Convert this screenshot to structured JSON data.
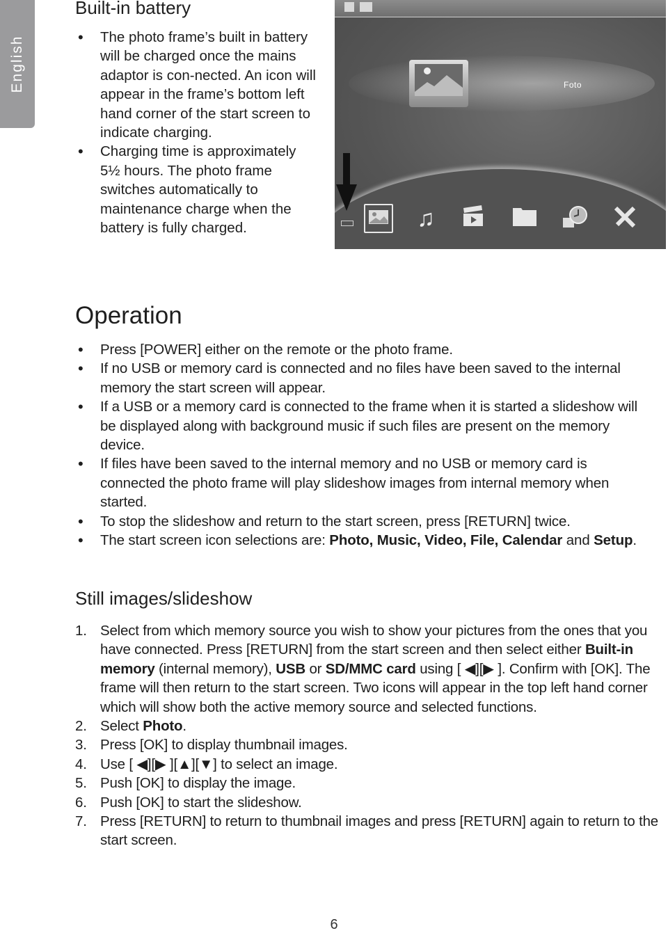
{
  "side_tab": {
    "label": "English"
  },
  "battery_section": {
    "heading": "Built-in battery",
    "bullets": [
      "The photo frame’s built in battery will be charged once the mains adaptor is con-nected. An icon will appear in the frame’s bottom left hand corner of the start screen to indicate charging.",
      "Charging time is approximately 5½ hours. The photo frame switches automatically to maintenance charge when the battery is fully charged."
    ]
  },
  "screen_image": {
    "selected_label": "Foto",
    "menu_icons": [
      "photo-icon",
      "music-icon",
      "video-icon",
      "file-icon",
      "calendar-icon",
      "setup-icon"
    ],
    "indicator": "battery-charging-icon",
    "pointer": "down-arrow-icon"
  },
  "operation_section": {
    "heading": "Operation",
    "bullets": [
      {
        "text": "Press [POWER] either on the remote or the photo frame."
      },
      {
        "text": "If no USB or memory card is connected and no files have been saved to the internal memory the start screen will appear."
      },
      {
        "text": "If a USB or a memory card is connected to the frame when it is started a slideshow will be displayed along with background music if such files are present on the memory device."
      },
      {
        "text": "If files have been saved to the internal memory and no USB or memory card is connected the photo frame will play slideshow images from internal memory when started."
      },
      {
        "text": "To stop the slideshow and return to the start screen, press [RETURN] twice."
      },
      {
        "prefix": "The start screen icon selections are: ",
        "bold1": "Photo, Music, Video, File, Calendar",
        "mid": " and ",
        "bold2": "Setup",
        "suffix": "."
      }
    ]
  },
  "still_section": {
    "heading": "Still images/slideshow",
    "steps": [
      {
        "num": "1.",
        "p1": "Select from which memory source you wish to show your pictures from the ones that you have connected. Press [RETURN] from the start screen and then select either ",
        "b1": "Built-in memory",
        "p2": " (internal memory), ",
        "b2": "USB",
        "p3": " or ",
        "b3": "SD/MMC card",
        "p4": " using [ ◀][▶ ]. Confirm with [OK]. The frame will then return to the start screen. Two icons will appear in the top left hand corner which will show both the active memory source and selected functions."
      },
      {
        "num": "2.",
        "p1": "Select ",
        "b1": "Photo",
        "p2": "."
      },
      {
        "num": "3.",
        "p1": "Press [OK] to display thumbnail images."
      },
      {
        "num": "4.",
        "p1": "Use [ ◀][▶ ][▲][▼] to select an image."
      },
      {
        "num": "5.",
        "p1": "Push [OK] to display the image."
      },
      {
        "num": "6.",
        "p1": "Push [OK] to start the slideshow."
      },
      {
        "num": "7.",
        "p1": "Press [RETURN] to return to thumbnail images and press [RETURN] again to return to the start screen."
      }
    ]
  },
  "page_number": "6"
}
